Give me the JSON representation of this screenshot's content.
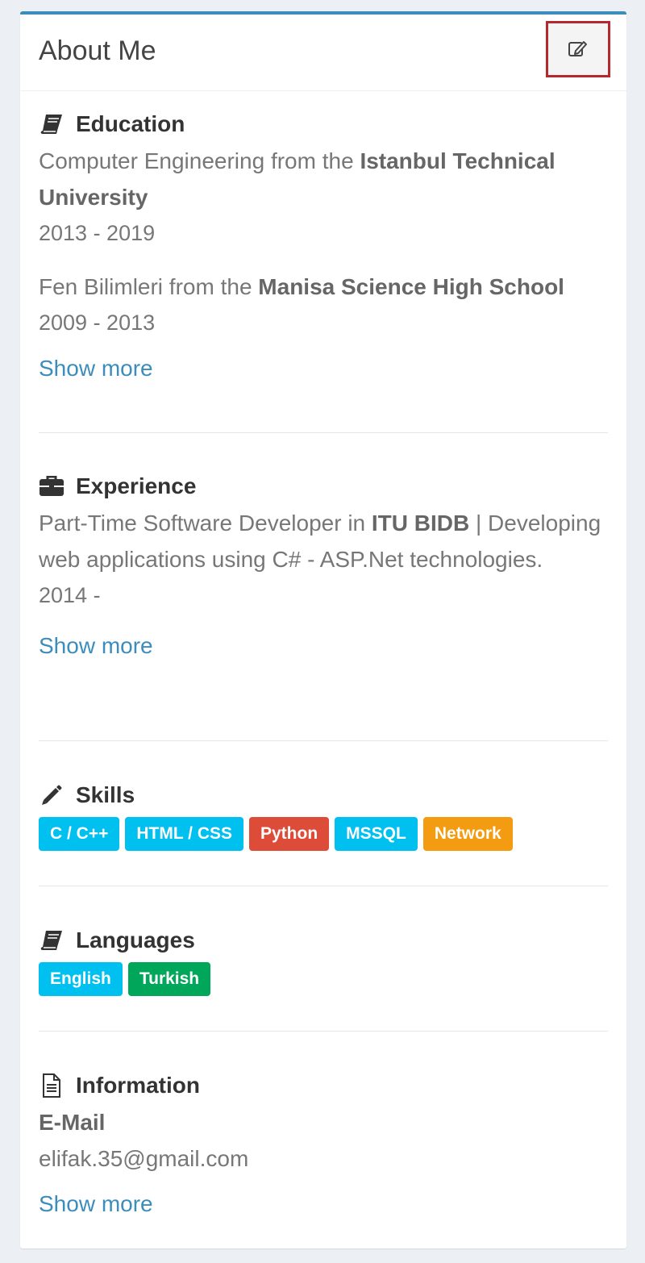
{
  "card": {
    "title": "About Me",
    "edit_icon": "edit-icon"
  },
  "education": {
    "heading": "Education",
    "icon": "book-icon",
    "entries": [
      {
        "prefix": "Computer Engineering from the ",
        "school": "Istanbul Technical University",
        "years": "2013 - 2019"
      },
      {
        "prefix": "Fen Bilimleri from the ",
        "school": "Manisa Science High School",
        "years": "2009 - 2013"
      }
    ],
    "show_more": "Show more"
  },
  "experience": {
    "heading": "Experience",
    "icon": "briefcase-icon",
    "prefix": "Part-Time Software Developer in ",
    "org": "ITU BIDB",
    "suffix": " | Developing web applications using C# - ASP.Net technologies.",
    "years": "2014 -",
    "show_more": "Show more"
  },
  "skills": {
    "heading": "Skills",
    "icon": "pencil-icon",
    "items": [
      {
        "label": "C / C++",
        "color": "#00c0ef"
      },
      {
        "label": "HTML / CSS",
        "color": "#00c0ef"
      },
      {
        "label": "Python",
        "color": "#dd4b39"
      },
      {
        "label": "MSSQL",
        "color": "#00c0ef"
      },
      {
        "label": "Network",
        "color": "#f39c12"
      }
    ]
  },
  "languages": {
    "heading": "Languages",
    "icon": "book-icon",
    "items": [
      {
        "label": "English",
        "color": "#00c0ef"
      },
      {
        "label": "Turkish",
        "color": "#00a65a"
      }
    ]
  },
  "information": {
    "heading": "Information",
    "icon": "file-text-icon",
    "email_label": "E-Mail",
    "email": "elifak.35@gmail.com",
    "show_more": "Show more"
  },
  "colors": {
    "accent": "#3c8dbc",
    "highlight_border": "#b7282e"
  }
}
